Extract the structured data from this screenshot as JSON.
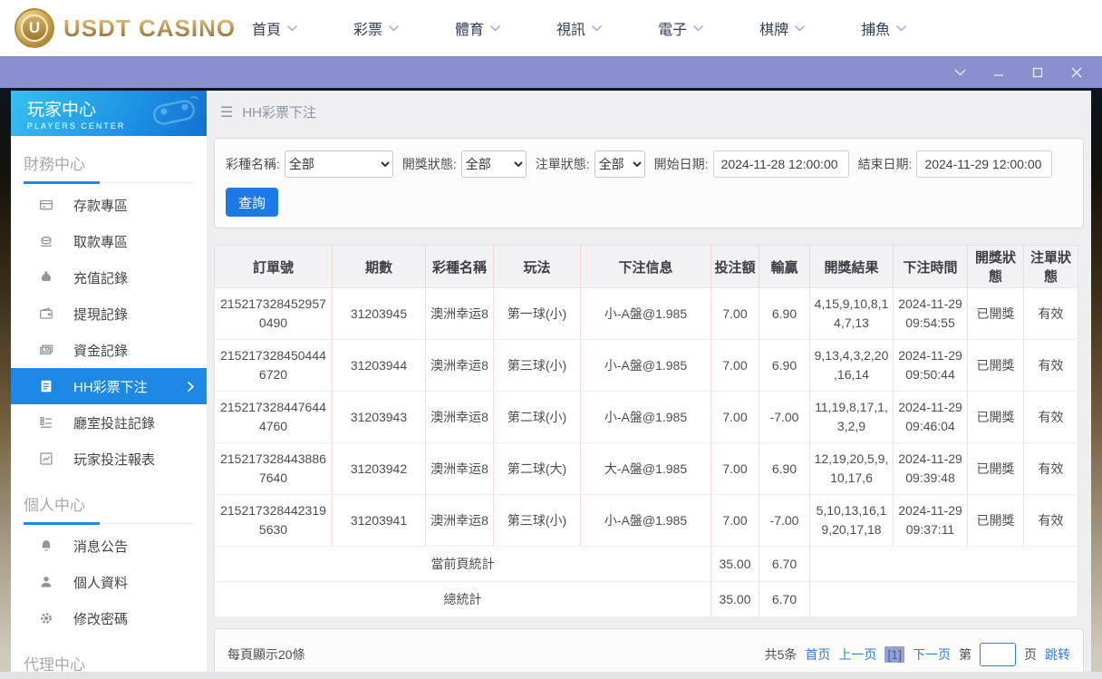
{
  "topnav": {
    "logo_text": "USDT CASINO",
    "items": [
      {
        "label": "首頁"
      },
      {
        "label": "彩票"
      },
      {
        "label": "體育"
      },
      {
        "label": "視訊"
      },
      {
        "label": "電子"
      },
      {
        "label": "棋牌"
      },
      {
        "label": "捕魚"
      }
    ]
  },
  "titlebar": {
    "controls": [
      "collapse",
      "minimize",
      "maximize",
      "close"
    ]
  },
  "sidebar": {
    "banner": {
      "title": "玩家中心",
      "subtitle": "PLAYERS CENTER"
    },
    "sections": [
      {
        "title": "財務中心",
        "items": [
          {
            "label": "存款專區",
            "icon": "deposit-icon"
          },
          {
            "label": "取款專區",
            "icon": "withdraw-icon"
          },
          {
            "label": "充值記錄",
            "icon": "recharge-record-icon"
          },
          {
            "label": "提現記錄",
            "icon": "withdrawal-record-icon"
          },
          {
            "label": "資金記錄",
            "icon": "funds-record-icon"
          },
          {
            "label": "HH彩票下注",
            "icon": "lottery-bet-icon",
            "active": true
          },
          {
            "label": "廳室投註記錄",
            "icon": "room-bet-record-icon"
          },
          {
            "label": "玩家投注報表",
            "icon": "player-report-icon"
          }
        ]
      },
      {
        "title": "個人中心",
        "items": [
          {
            "label": "消息公告",
            "icon": "bell-icon"
          },
          {
            "label": "個人資料",
            "icon": "person-icon"
          },
          {
            "label": "修改密碼",
            "icon": "gear-icon"
          }
        ]
      },
      {
        "title": "代理中心",
        "items": []
      }
    ]
  },
  "main": {
    "header_title": "HH彩票下注"
  },
  "filters": {
    "lottery": {
      "label": "彩種名稱:",
      "value": "全部"
    },
    "draw_status": {
      "label": "開獎狀態:",
      "value": "全部"
    },
    "order_status": {
      "label": "注單狀態:",
      "value": "全部"
    },
    "start_date": {
      "label": "開始日期:",
      "value": "2024-11-28 12:00:00"
    },
    "end_date": {
      "label": "結束日期:",
      "value": "2024-11-29 12:00:00"
    },
    "search_button": "查詢"
  },
  "table": {
    "headers": [
      "訂單號",
      "期數",
      "彩種名稱",
      "玩法",
      "下注信息",
      "投注額",
      "輸贏",
      "開獎結果",
      "下注時間",
      "開獎狀態",
      "注單狀態"
    ],
    "rows": [
      {
        "order_id": "2152173284529570490",
        "period": "31203945",
        "lottery": "澳洲幸运8",
        "play": "第一球(小)",
        "bet_info": "小-A盤@1.985",
        "bet_amount": "7.00",
        "win_loss": "6.90",
        "result": "4,15,9,10,8,14,7,13",
        "bet_time": "2024-11-29 09:54:55",
        "draw_status": "已開獎",
        "order_status": "有效"
      },
      {
        "order_id": "2152173284504446720",
        "period": "31203944",
        "lottery": "澳洲幸运8",
        "play": "第三球(小)",
        "bet_info": "小-A盤@1.985",
        "bet_amount": "7.00",
        "win_loss": "6.90",
        "result": "9,13,4,3,2,20,16,14",
        "bet_time": "2024-11-29 09:50:44",
        "draw_status": "已開獎",
        "order_status": "有效"
      },
      {
        "order_id": "2152173284476444760",
        "period": "31203943",
        "lottery": "澳洲幸运8",
        "play": "第二球(小)",
        "bet_info": "小-A盤@1.985",
        "bet_amount": "7.00",
        "win_loss": "-7.00",
        "result": "11,19,8,17,1,3,2,9",
        "bet_time": "2024-11-29 09:46:04",
        "draw_status": "已開獎",
        "order_status": "有效"
      },
      {
        "order_id": "2152173284438867640",
        "period": "31203942",
        "lottery": "澳洲幸运8",
        "play": "第二球(大)",
        "bet_info": "大-A盤@1.985",
        "bet_amount": "7.00",
        "win_loss": "6.90",
        "result": "12,19,20,5,9,10,17,6",
        "bet_time": "2024-11-29 09:39:48",
        "draw_status": "已開獎",
        "order_status": "有效"
      },
      {
        "order_id": "2152173284423195630",
        "period": "31203941",
        "lottery": "澳洲幸运8",
        "play": "第三球(小)",
        "bet_info": "小-A盤@1.985",
        "bet_amount": "7.00",
        "win_loss": "-7.00",
        "result": "5,10,13,16,19,20,17,18",
        "bet_time": "2024-11-29 09:37:11",
        "draw_status": "已開獎",
        "order_status": "有效"
      }
    ],
    "summary": {
      "current": {
        "label": "當前頁統計",
        "bet": "35.00",
        "win": "6.70"
      },
      "total": {
        "label": "總統計",
        "bet": "35.00",
        "win": "6.70"
      }
    }
  },
  "pager": {
    "per_page": "每頁顯示20條",
    "total": "共5条",
    "first": "首页",
    "prev": "上一页",
    "current": "[1]",
    "next": "下一页",
    "page_prefix": "第",
    "page_suffix": "页",
    "jump": "跳转",
    "page_input_value": ""
  },
  "icons": {
    "menu": "☰"
  },
  "colors": {
    "accent_blue": "#1e88e5",
    "link_blue": "#2a7de1",
    "titlebar_purple": "#8a8fd0",
    "banner_blue_start": "#36c0f1",
    "banner_blue_end": "#1470cf",
    "logo_gold": "#b3914d",
    "table_border_pink": "#f3d5d5"
  }
}
